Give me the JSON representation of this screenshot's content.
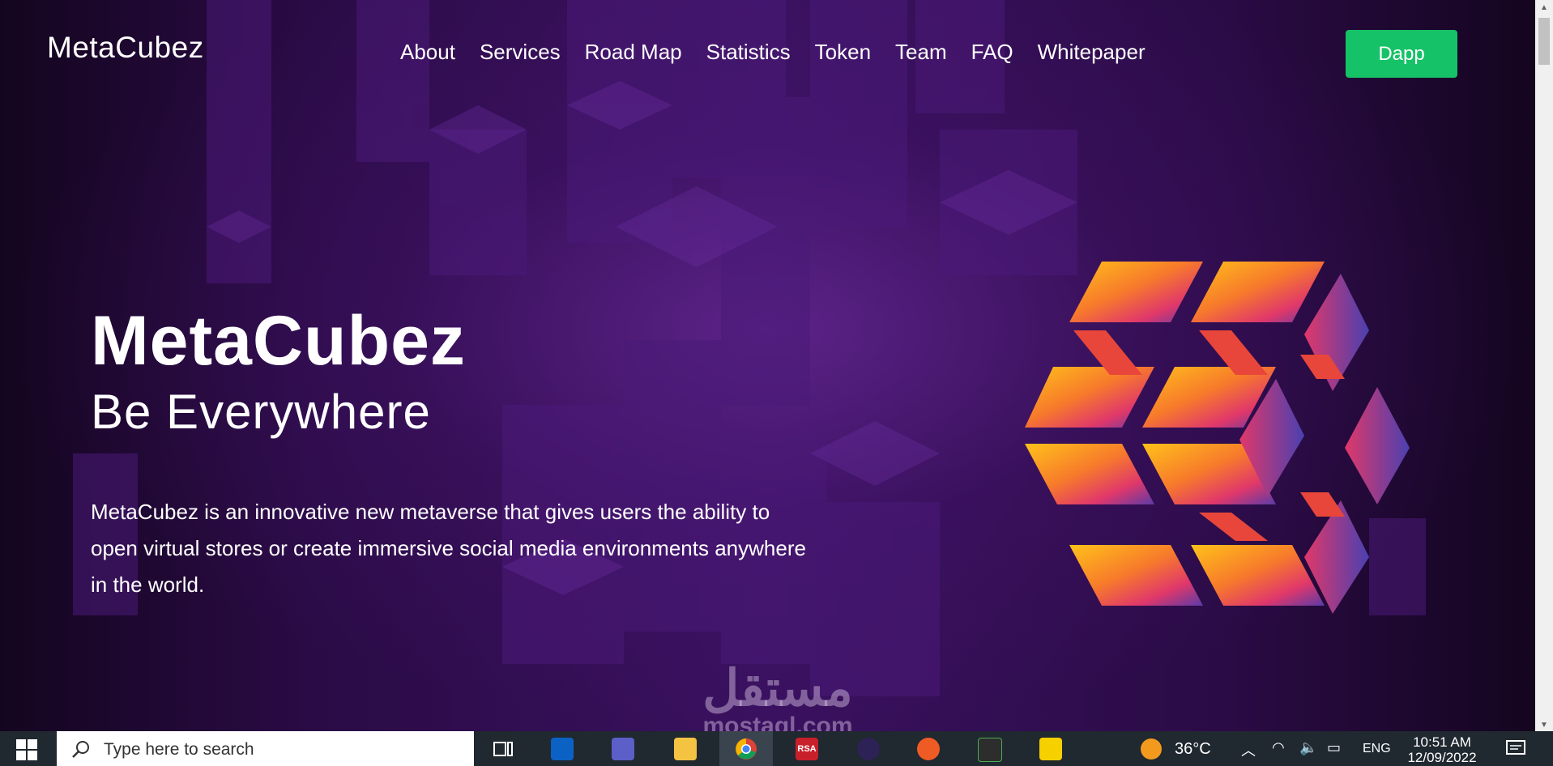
{
  "logo": "MetaCubez",
  "nav": [
    "About",
    "Services",
    "Road Map",
    "Statistics",
    "Token",
    "Team",
    "FAQ",
    "Whitepaper"
  ],
  "dapp_label": "Dapp",
  "hero": {
    "title": "MetaCubez",
    "subtitle": "Be Everywhere",
    "description": "MetaCubez is an innovative new metaverse that gives users the ability to open virtual stores or create immersive social media environments anywhere in the world."
  },
  "watermark": {
    "arabic": "مستقل",
    "latin": "mostaql.com"
  },
  "taskbar": {
    "search_placeholder": "Type here to search",
    "weather_temp": "36°C",
    "language": "ENG",
    "time": "10:51 AM",
    "date": "12/09/2022",
    "apps": [
      "task-view-icon",
      "outlook-icon",
      "teams-icon",
      "file-explorer-icon",
      "chrome-icon",
      "rsa-icon",
      "eclipse-icon",
      "postman-icon",
      "sublime-icon",
      "sticky-notes-icon"
    ],
    "rsa_label": "RSA"
  },
  "colors": {
    "accent_green": "#16c267",
    "bg_purple": "#3a1160",
    "taskbar": "#202830"
  }
}
